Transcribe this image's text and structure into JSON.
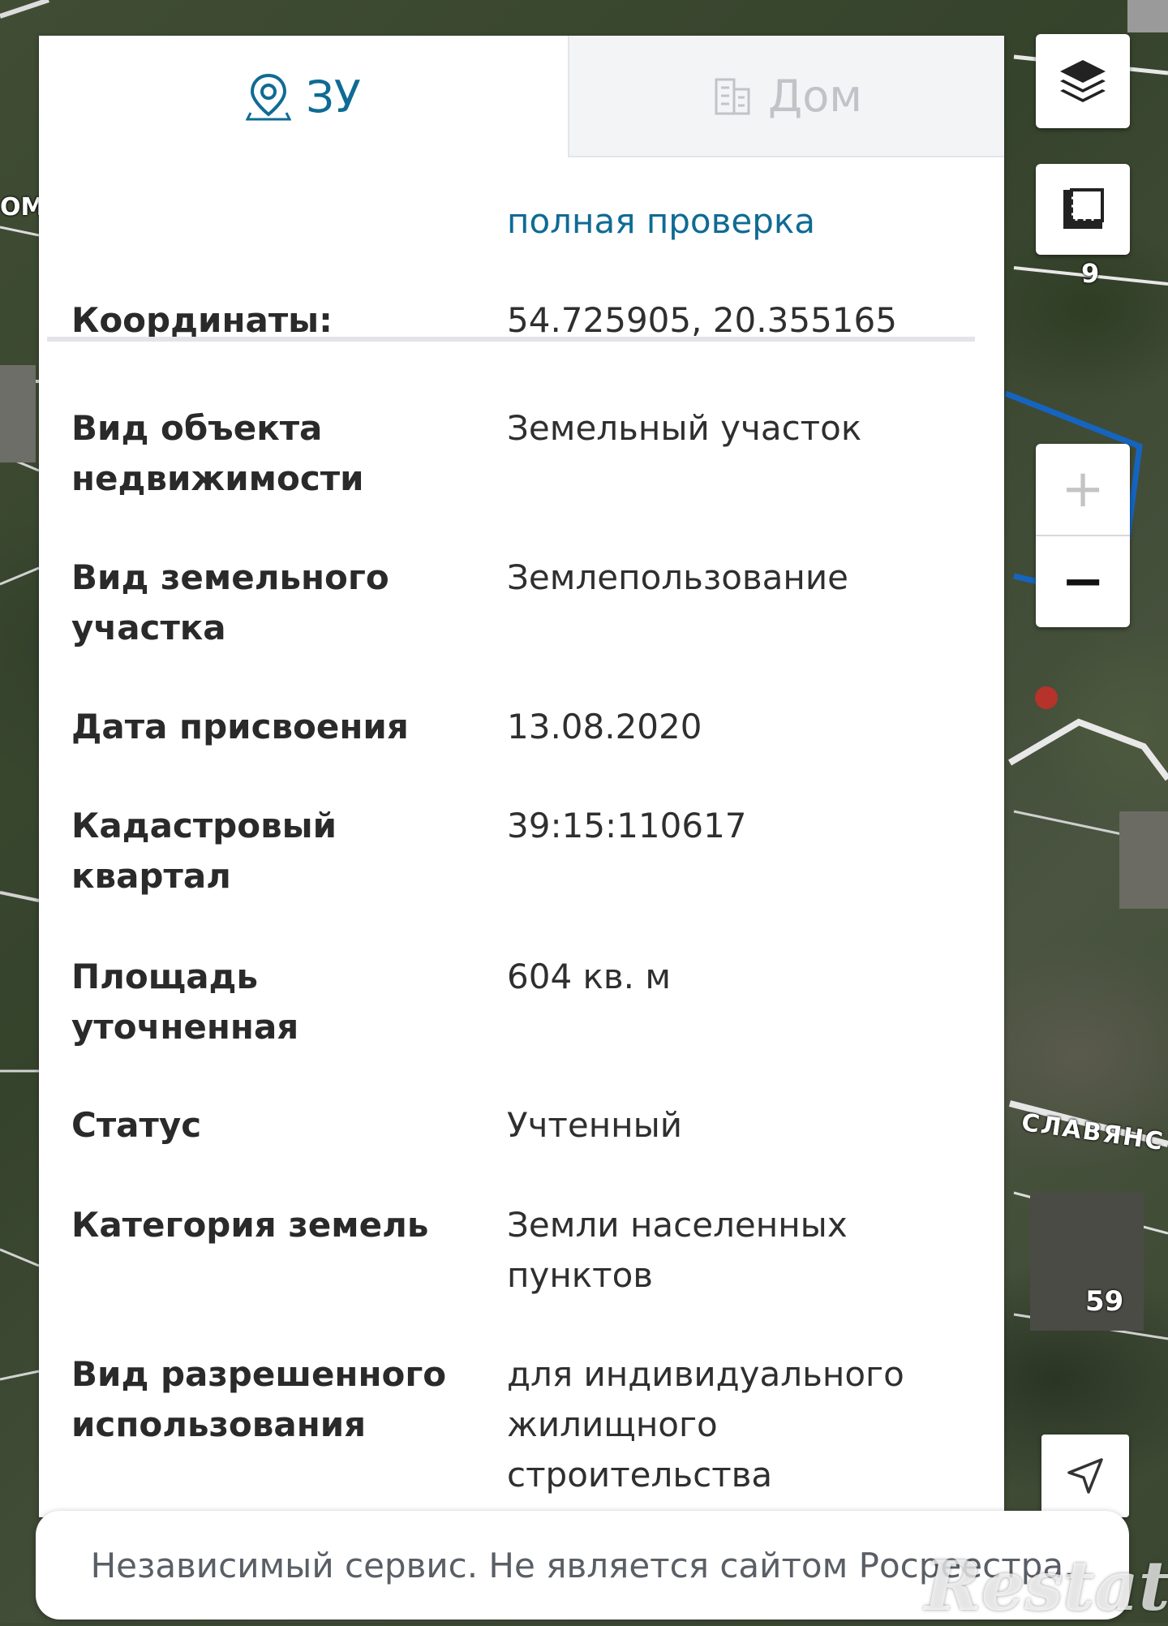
{
  "tabs": [
    {
      "label": "ЗУ",
      "active": true
    },
    {
      "label": "Дом",
      "active": false
    }
  ],
  "details": {
    "check_link": "полная проверка",
    "rows": [
      {
        "label": "Координаты:",
        "value": "54.725905, 20.355165"
      },
      {
        "label": "Вид объекта недвижимости",
        "value": "Земельный участок"
      },
      {
        "label": "Вид земельного участка",
        "value": "Землепользование"
      },
      {
        "label": "Дата присвоения",
        "value": "13.08.2020"
      },
      {
        "label": "Кадастровый квартал",
        "value": "39:15:110617"
      },
      {
        "label": "Площадь уточненная",
        "value": "604 кв. м"
      },
      {
        "label": "Статус",
        "value": "Учтенный"
      },
      {
        "label": "Категория земель",
        "value": "Земли населенных пунктов"
      },
      {
        "label": "Вид разрешенного использования",
        "value": "для индивидуального жилищного строительства"
      }
    ]
  },
  "map": {
    "street_label": "СЛАВЯНС",
    "house_numbers": [
      "9",
      "59"
    ],
    "partial_label": "ОМ",
    "parcel_outline_color": "#1565c0"
  },
  "controls": {
    "zoom_in": "+",
    "zoom_out": "−"
  },
  "footer": {
    "disclaimer": "Независимый сервис. Не является сайтом Росреестра."
  },
  "watermark": "Restate",
  "colors": {
    "accent": "#0f6b94",
    "label_text": "#2a2a2a",
    "inactive_tab": "#c0c4c8"
  }
}
